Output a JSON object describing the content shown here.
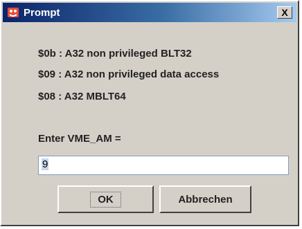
{
  "window": {
    "title": "Prompt",
    "close_label": "X"
  },
  "messages": [
    "$0b : A32 non privileged BLT32",
    "$09 : A32 non privileged data access",
    "$08 : A32 MBLT64"
  ],
  "form": {
    "label": "Enter VME_AM =",
    "value": "9"
  },
  "buttons": {
    "ok": "OK",
    "cancel": "Abbrechen"
  }
}
